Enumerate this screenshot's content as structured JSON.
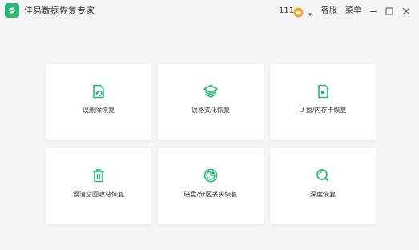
{
  "app": {
    "title": "佳易数据恢复专家"
  },
  "titlebar": {
    "coins": "111",
    "service_label": "客服",
    "menu_label": "菜单"
  },
  "colors": {
    "accent": "#2bb673",
    "icon": "#2bb673",
    "coin": "#f5a623"
  },
  "cards": [
    {
      "label": "误删除恢复",
      "icon": "recycle-file-icon"
    },
    {
      "label": "误格式化恢复",
      "icon": "layers-icon"
    },
    {
      "label": "U 盘/内存卡恢复",
      "icon": "sd-card-icon"
    },
    {
      "label": "误清空回收站恢复",
      "icon": "trash-icon"
    },
    {
      "label": "磁盘/分区丢失恢复",
      "icon": "pie-disk-icon"
    },
    {
      "label": "深度恢复",
      "icon": "deep-search-icon"
    }
  ]
}
